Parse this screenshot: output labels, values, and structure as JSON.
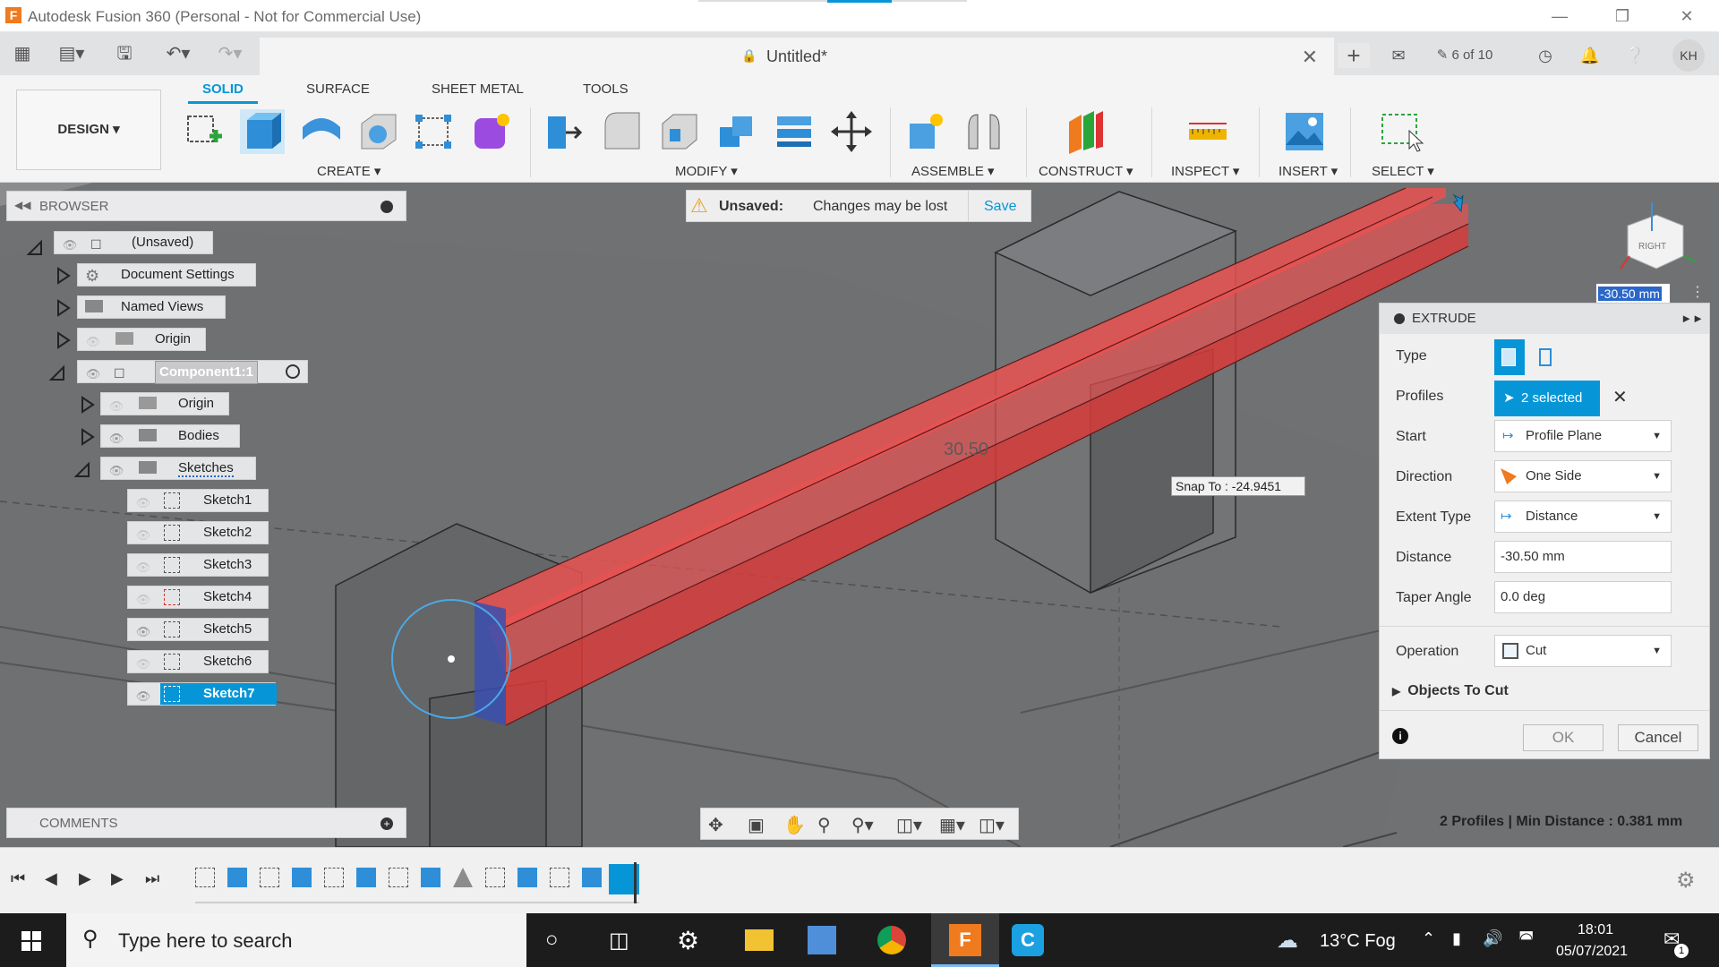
{
  "window": {
    "title": "Autodesk Fusion 360 (Personal - Not for Commercial Use)",
    "app_icon": "F"
  },
  "doc_tab": {
    "name": "Untitled*",
    "jobs": "6 of 10",
    "user_initials": "KH"
  },
  "ribbon": {
    "workspace": "DESIGN",
    "tabs": [
      "SOLID",
      "SURFACE",
      "SHEET METAL",
      "TOOLS"
    ],
    "groups": [
      "CREATE",
      "MODIFY",
      "ASSEMBLE",
      "CONSTRUCT",
      "INSPECT",
      "INSERT",
      "SELECT"
    ]
  },
  "banner": {
    "label": "Unsaved:",
    "message": "Changes may be lost",
    "action": "Save"
  },
  "browser": {
    "title": "BROWSER",
    "root": "(Unsaved)",
    "items": {
      "document_settings": "Document Settings",
      "named_views": "Named Views",
      "origin": "Origin",
      "component": "Component1:1",
      "comp_origin": "Origin",
      "bodies": "Bodies",
      "sketches": "Sketches"
    },
    "sketches": [
      "Sketch1",
      "Sketch2",
      "Sketch3",
      "Sketch4",
      "Sketch5",
      "Sketch6",
      "Sketch7"
    ]
  },
  "viewport": {
    "dimension_label": "30.50",
    "snap_tooltip": "Snap To : -24.9451",
    "distance_input": "-30.50 mm",
    "viewcube_face": "RIGHT",
    "status": "2 Profiles | Min Distance : 0.381 mm"
  },
  "extrude": {
    "title": "EXTRUDE",
    "labels": {
      "type": "Type",
      "profiles": "Profiles",
      "start": "Start",
      "direction": "Direction",
      "extent_type": "Extent Type",
      "distance": "Distance",
      "taper_angle": "Taper Angle",
      "operation": "Operation",
      "objects_to_cut": "Objects To Cut"
    },
    "profiles_value": "2 selected",
    "start_value": "Profile Plane",
    "direction_value": "One Side",
    "extent_value": "Distance",
    "distance_value": "-30.50 mm",
    "taper_value": "0.0 deg",
    "operation_value": "Cut",
    "ok": "OK",
    "cancel": "Cancel"
  },
  "comments": {
    "title": "COMMENTS"
  },
  "taskbar": {
    "search_placeholder": "Type here to search",
    "weather": "13°C  Fog",
    "time": "18:01",
    "date": "05/07/2021",
    "notification_count": "1"
  },
  "colors": {
    "accent": "#0696d7",
    "extrude_cut": "#e95151",
    "viewport_bg": "#6f7173"
  }
}
